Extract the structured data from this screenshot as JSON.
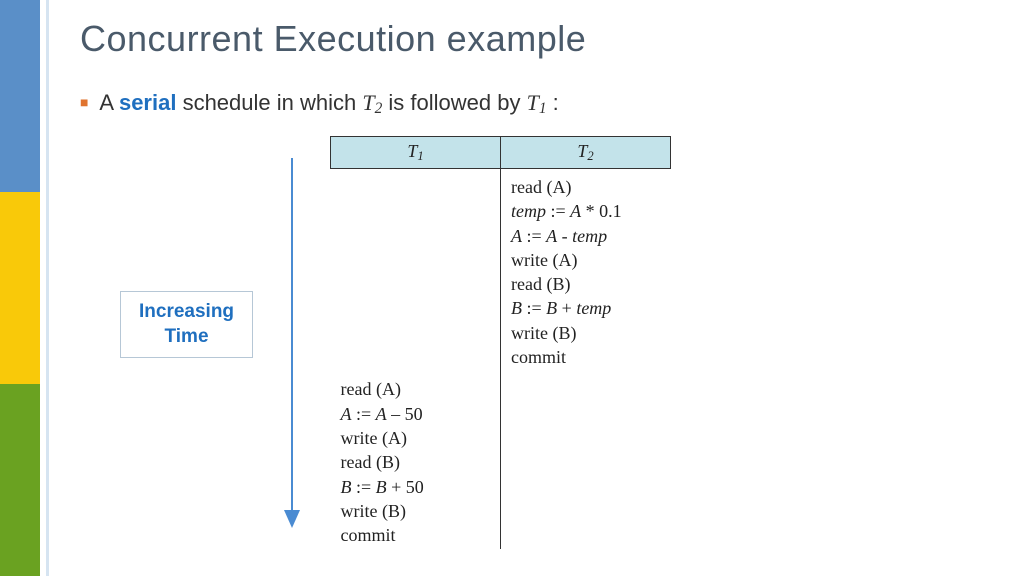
{
  "title": "Concurrent Execution example",
  "bullet": {
    "prefix": "A ",
    "keyword": "serial",
    "mid": " schedule in which ",
    "t2": "T",
    "t2sub": "2",
    "mid2": " is followed by ",
    "t1": "T",
    "t1sub": "1",
    "tail": " :"
  },
  "arrow_label": {
    "line1": "Increasing",
    "line2": "Time"
  },
  "table": {
    "h1": "T",
    "h1sub": "1",
    "h2": "T",
    "h2sub": "2",
    "t2_ops": [
      "read (A)",
      "temp := A * 0.1",
      "A := A - temp",
      "write (A)",
      "read (B)",
      "B := B + temp",
      "write (B)",
      "commit"
    ],
    "t1_ops": [
      "read (A)",
      "A := A – 50",
      "write (A)",
      "read (B)",
      "B := B + 50",
      "write (B)",
      "commit"
    ]
  }
}
